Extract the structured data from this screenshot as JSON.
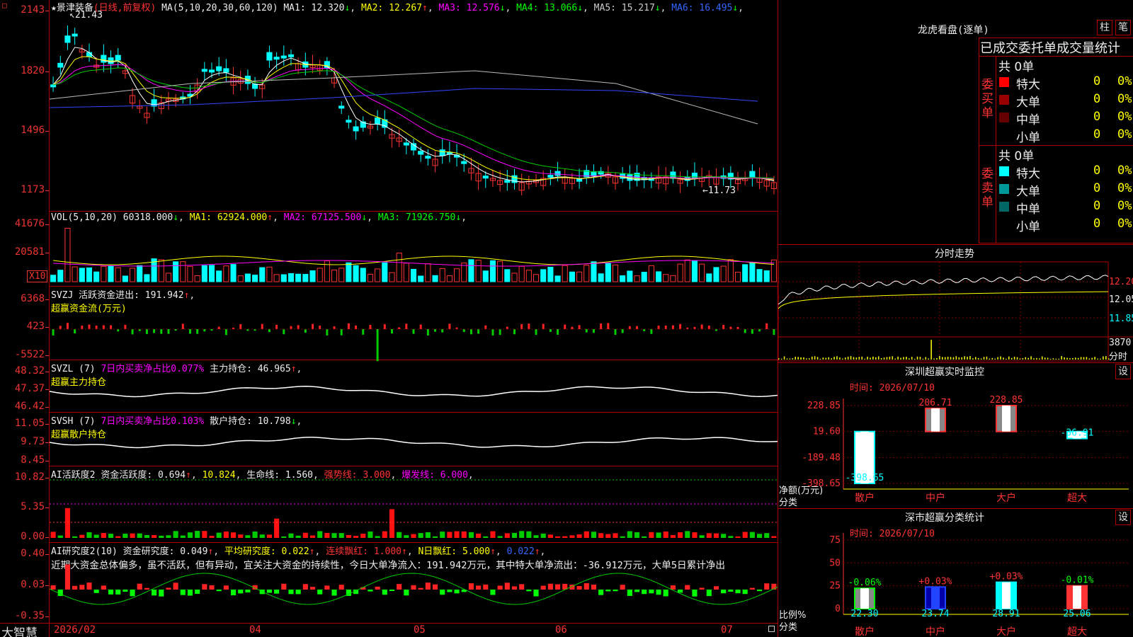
{
  "stock": {
    "name": "景津装备",
    "mode": "(日线,前复权)",
    "star": "★"
  },
  "ma_header": {
    "label": "MA(5,10,20,30,60,120)",
    "items": [
      {
        "name": "MA1",
        "value": "12.320",
        "arrow": "↓",
        "color": "#eeeeee"
      },
      {
        "name": "MA2",
        "value": "12.267",
        "arrow": "↑",
        "color": "#ffff00"
      },
      {
        "name": "MA3",
        "value": "12.576",
        "arrow": "↓",
        "color": "#ff00ff"
      },
      {
        "name": "MA4",
        "value": "13.066",
        "arrow": "↓",
        "color": "#00ff00"
      },
      {
        "name": "MA5",
        "value": "15.217",
        "arrow": "↓",
        "color": "#cccccc"
      },
      {
        "name": "MA6",
        "value": "16.495",
        "arrow": "↓",
        "color": "#3366ff"
      }
    ]
  },
  "price_ticks": [
    "2143",
    "1820",
    "1496",
    "1173"
  ],
  "price_marks": {
    "high": "21.43",
    "low": "11.73"
  },
  "vol_header": {
    "label": "VOL(5,10,20)",
    "value": "60318.000",
    "arrow": "↓",
    "items": [
      {
        "name": "MA1",
        "value": "62924.000",
        "arrow": "↑",
        "color": "#ffff00"
      },
      {
        "name": "MA2",
        "value": "67125.500",
        "arrow": "↓",
        "color": "#ff00ff"
      },
      {
        "name": "MA3",
        "value": "71926.750",
        "arrow": "↓",
        "color": "#00ff00"
      }
    ]
  },
  "vol_ticks": [
    "41676",
    "20581"
  ],
  "vol_unit": "X10",
  "svzj": {
    "line1": "SVZJ  活跃资金进出: 191.942",
    "arrow": "↑",
    "line2": "超赢资金流(万元)",
    "ticks": [
      "6368",
      "423",
      "-5522"
    ]
  },
  "svzl": {
    "label": "SVZL (7)",
    "part1": "7日内买卖净占比0.077%",
    "part2": "主力持仓: 46.965",
    "arrow": "↑",
    "line2": "超赢主力持仓",
    "ticks": [
      "48.32",
      "47.37",
      "46.42"
    ]
  },
  "svsh": {
    "label": "SVSH (7)",
    "part1": "7日内买卖净占比0.103%",
    "part2": "散户持仓: 10.798",
    "arrow": "↓",
    "line2": "超赢散户持仓",
    "ticks": [
      "11.05",
      "9.73",
      "8.45"
    ]
  },
  "ai_active": {
    "label": "AI活跃度2",
    "part1": "资金活跃度: 0.694",
    "part2": "10.824",
    "part3": "生命线: 1.560",
    "part4": "强势线: 3.000",
    "part5": "爆发线: 6.000",
    "ticks": [
      "10.82",
      "5.35",
      "0.00"
    ]
  },
  "ai_research": {
    "label": "AI研究度2(10)",
    "part1": "资金研究度: 0.049",
    "part2": "平均研究度: 0.022",
    "part3": "连续飘红: 1.000",
    "part4": "N日飘红: 5.000",
    "part5": "0.022",
    "text": "近期大资金总体偏多，虽不活跃，但有异动，宜关注大资金的持续性，今日大单净流入：191.942万元，其中特大单净流出：-36.912万元，大单5日累计净出",
    "ticks": [
      "0.40",
      "0.03",
      "-0.35"
    ]
  },
  "date_axis": {
    "brand": "大智慧",
    "labels": [
      "2026/02",
      "04",
      "05",
      "06",
      "07"
    ]
  },
  "dragon": {
    "title": "龙虎看盘(逐单)",
    "btn1": "柱",
    "btn2": "笔",
    "subtitle": "已成交委托单成交量统计",
    "buy": {
      "side": "委买单",
      "total": "共 0单",
      "rows": [
        {
          "name": "特大",
          "val": "0",
          "pct": "0%",
          "color": "#ff0000"
        },
        {
          "name": "大单",
          "val": "0",
          "pct": "0%",
          "color": "#990000"
        },
        {
          "name": "中单",
          "val": "0",
          "pct": "0%",
          "color": "#660000"
        },
        {
          "name": "小单",
          "val": "0",
          "pct": "0%",
          "color": "#000000"
        }
      ]
    },
    "sell": {
      "side": "委卖单",
      "total": "共 0单",
      "rows": [
        {
          "name": "特大",
          "val": "0",
          "pct": "0%",
          "color": "#00ffff"
        },
        {
          "name": "大单",
          "val": "0",
          "pct": "0%",
          "color": "#009999"
        },
        {
          "name": "中单",
          "val": "0",
          "pct": "0%",
          "color": "#006666"
        },
        {
          "name": "小单",
          "val": "0",
          "pct": "0%",
          "color": "#000000"
        }
      ]
    }
  },
  "intraday": {
    "title": "分时走势",
    "ticks": [
      "12.20",
      "12.05",
      "11.85"
    ],
    "vol_tick": "3870",
    "vol_label": "分时"
  },
  "sz_monitor": {
    "title": "深圳超赢实时监控",
    "btn": "设",
    "time": "时间: 2026/07/10",
    "ticks": [
      "228.85",
      "19.60",
      "-189.48",
      "-398.65"
    ],
    "ylabel": "净额(万元)",
    "xlabel": "分类",
    "chart_data": {
      "type": "bar",
      "categories": [
        "散户",
        "中户",
        "大户",
        "超大"
      ],
      "values": [
        -398.65,
        206.71,
        228.85,
        -36.91
      ],
      "ylim": [
        -398.65,
        228.85
      ]
    }
  },
  "sz_stats": {
    "title": "深市超赢分类统计",
    "btn": "设",
    "time": "时间: 2026/07/10",
    "ticks": [
      "75",
      "50",
      "25",
      "0"
    ],
    "ylabel": "比例%",
    "xlabel": "分类",
    "chart_data": {
      "type": "bar",
      "categories": [
        "散户",
        "中户",
        "大户",
        "超大"
      ],
      "values": [
        22.3,
        23.74,
        28.91,
        25.06
      ],
      "changes": [
        "-0.06%",
        "+0.03%",
        "+0.03%",
        "-0.01%"
      ],
      "ylim": [
        0,
        75
      ]
    }
  }
}
